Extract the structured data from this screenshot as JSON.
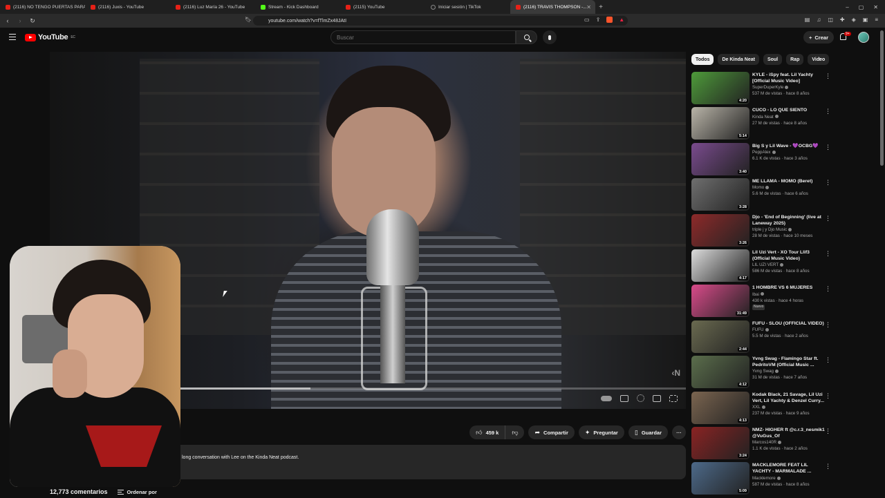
{
  "browser": {
    "tabs": [
      {
        "title": "(2116) NO TENGO PUERTAS PARA D...",
        "icon": "youtube-icon"
      },
      {
        "title": "(2116) Juxis - YouTube",
        "icon": "youtube-icon"
      },
      {
        "title": "(2116) Luz María 26 - YouTube",
        "icon": "youtube-icon"
      },
      {
        "title": "Stream - Kick Dashboard",
        "icon": "kick-icon"
      },
      {
        "title": "(2115) YouTube",
        "icon": "youtube-icon"
      },
      {
        "title": "Iniciar sesión | TikTok",
        "icon": "tiktok-icon"
      },
      {
        "title": "(2116) TRAVIS THOMPSON -...",
        "icon": "youtube-icon",
        "active": true
      }
    ],
    "url": "youtube.com/watch?v=fTlmZx48JAtI"
  },
  "header": {
    "logo_text": "YouTube",
    "region": "EC",
    "search_placeholder": "Buscar",
    "create_label": "Crear",
    "notif_badge": "9+"
  },
  "player": {
    "progress_fraction": 0.41,
    "watermark": "‹N"
  },
  "actions": {
    "likes": "459 k",
    "share": "Compartir",
    "ask": "Preguntar",
    "save": "Guardar"
  },
  "description": "long conversation with Lee on the Kinda Neat podcast.",
  "comments": {
    "count": "12,773 comentarios",
    "sort": "Ordenar por"
  },
  "chips": [
    "Todos",
    "De Kinda Neat",
    "Soul",
    "Rap",
    "Video"
  ],
  "recommendations": [
    {
      "title": "KYLE - iSpy feat. Lil Yachty [Official Music Video]",
      "channel": "SuperDuperKyle",
      "stats": "537 M de vistas · hace 8 años",
      "duration": "4:20",
      "color": "#4e9a3a"
    },
    {
      "title": "CUCO - LO QUE SIENTO",
      "channel": "Kinda Neat",
      "stats": "27 M de vistas · hace 8 años",
      "duration": "5:14",
      "color": "#b9b4a8"
    },
    {
      "title": "Big S y Lil Wave - 💜OCBG💜",
      "channel": "PeppAlex",
      "stats": "6.1 K de vistas · hace 3 años",
      "duration": "3:40",
      "color": "#7a4b8e"
    },
    {
      "title": "ME LLAMA - MOMO (Beret)",
      "channel": "Momo",
      "stats": "5.6 M de vistas · hace 6 años",
      "duration": "3:28",
      "color": "#6f6f6f"
    },
    {
      "title": "Djo - 'End of Beginning' (live at Laneway 2025)",
      "channel": "triple j y Djo Music",
      "stats": "28 M de vistas · hace 10 meses",
      "duration": "3:26",
      "color": "#8e2a2a"
    },
    {
      "title": "Lil Uzi Vert - XO Tour Llif3 (Official Music Video)",
      "channel": "LIL UZI VERT",
      "stats": "586 M de vistas · hace 8 años",
      "duration": "4:17",
      "color": "#dcdcdc"
    },
    {
      "title": "1 HOMBRE VS 6 MUJERES",
      "channel": "Ibai",
      "stats": "430 k vistas · hace 4 horas",
      "duration": "31:49",
      "color": "#d94b8a",
      "badge": "Nuevo"
    },
    {
      "title": "FUFU - SLOU (OFFICIAL VIDEO)",
      "channel": "FUFU",
      "stats": "5.5 M de vistas · hace 2 años",
      "duration": "2:44",
      "color": "#6a6a50"
    },
    {
      "title": "Yvng Swag - Flamingo Star ft. PedritoVM (Official Music ...",
      "channel": "Yvng Swag",
      "stats": "31 M de vistas · hace 7 años",
      "duration": "4:12",
      "color": "#5b6e4c"
    },
    {
      "title": "Kodak Black, 21 Savage, Lil Uzi Vert, Lil Yachty & Denzel Curry...",
      "channel": "XXL",
      "stats": "237 M de vistas · hace 9 años",
      "duration": "4:13",
      "color": "#7b6550"
    },
    {
      "title": "NMZ- HIGHER ft @c.r.3_nesmik1 @VuGus_Of",
      "channel": "Marcos140R",
      "stats": "1.1 K de vistas · hace 2 años",
      "duration": "3:24",
      "color": "#8a2323"
    },
    {
      "title": "MACKLEMORE FEAT LIL YACHTY - MARMALADE ...",
      "channel": "Macklemore",
      "stats": "587 M de vistas · hace 8 años",
      "duration": "5:09",
      "color": "#4d6a8a"
    }
  ]
}
